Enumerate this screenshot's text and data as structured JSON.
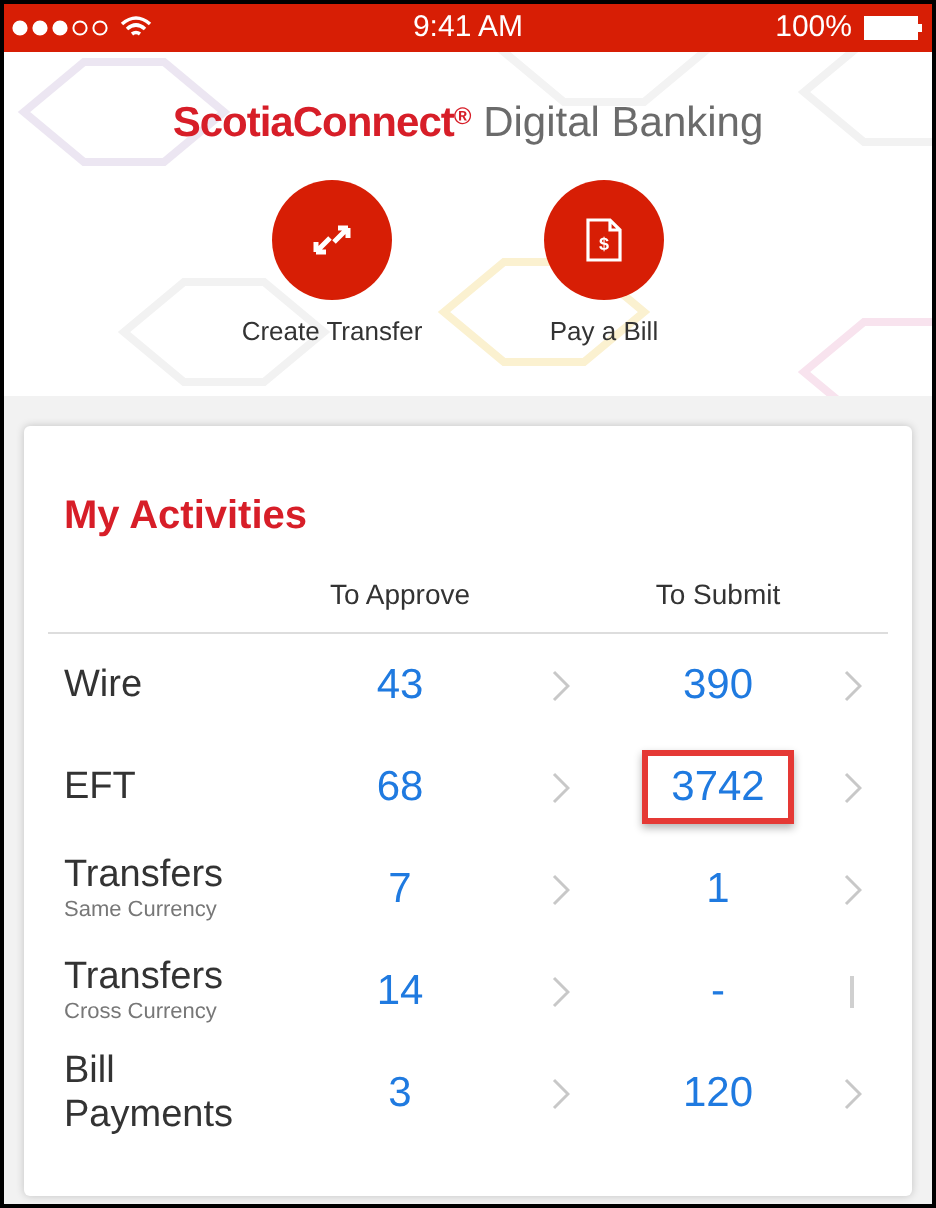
{
  "status_bar": {
    "time": "9:41 AM",
    "battery": "100%"
  },
  "header": {
    "brand": "ScotiaConnect",
    "brand_mark": "®",
    "product": "Digital Banking",
    "actions": [
      {
        "kind": "transfer",
        "label": "Create Transfer"
      },
      {
        "kind": "bill",
        "icon_text": "$",
        "label": "Pay a Bill"
      }
    ]
  },
  "activities": {
    "title": "My Activities",
    "columns": [
      "To Approve",
      "To Submit"
    ],
    "rows": [
      {
        "label": "Wire",
        "cells": [
          {
            "value": "43",
            "highlighted": false,
            "kind": "chevron"
          },
          {
            "value": "390",
            "highlighted": false,
            "kind": "chevron"
          }
        ]
      },
      {
        "label": "EFT",
        "cells": [
          {
            "value": "68",
            "highlighted": false,
            "kind": "chevron"
          },
          {
            "value": "3742",
            "highlighted": true,
            "kind": "chevron"
          }
        ]
      },
      {
        "label": "Transfers",
        "sublabel": "Same Currency",
        "cells": [
          {
            "value": "7",
            "highlighted": false,
            "kind": "chevron"
          },
          {
            "value": "1",
            "highlighted": false,
            "kind": "chevron"
          }
        ]
      },
      {
        "label": "Transfers",
        "sublabel": "Cross Currency",
        "cells": [
          {
            "value": "14",
            "highlighted": false,
            "kind": "chevron"
          },
          {
            "value": "-",
            "highlighted": false,
            "kind": "bar"
          }
        ]
      },
      {
        "label": "Bill Payments",
        "cells": [
          {
            "value": "3",
            "highlighted": false,
            "kind": "chevron"
          },
          {
            "value": "120",
            "highlighted": false,
            "kind": "chevron"
          }
        ]
      }
    ]
  }
}
